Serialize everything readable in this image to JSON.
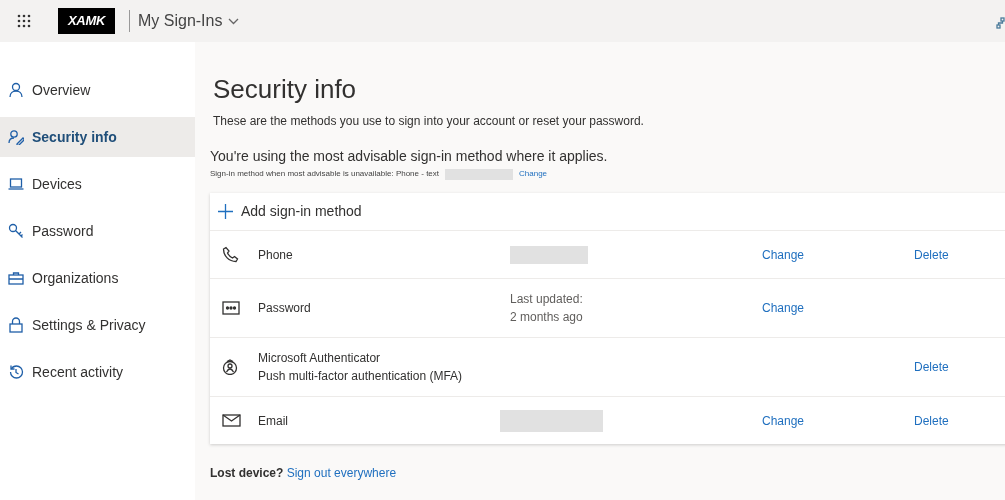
{
  "header": {
    "app_title": "My Sign-Ins",
    "logo_text": "XAMK"
  },
  "sidebar": {
    "items": [
      {
        "label": "Overview",
        "kind": "person",
        "selected": false
      },
      {
        "label": "Security info",
        "kind": "security",
        "selected": true
      },
      {
        "label": "Devices",
        "kind": "devices",
        "selected": false
      },
      {
        "label": "Password",
        "kind": "password",
        "selected": false
      },
      {
        "label": "Organizations",
        "kind": "organizations",
        "selected": false
      },
      {
        "label": "Settings & Privacy",
        "kind": "settings",
        "selected": false
      },
      {
        "label": "Recent activity",
        "kind": "activity",
        "selected": false
      }
    ]
  },
  "main": {
    "title": "Security info",
    "subtitle": "These are the methods you use to sign into your account or reset your password.",
    "advisable_note": "You're using the most advisable sign-in method where it applies.",
    "fallback_note": "Sign-in method when most advisable is unavailable: Phone - text",
    "fallback_redacted": true,
    "fallback_link": "Change",
    "add_method": "Add sign-in method",
    "methods": [
      {
        "kind": "phone",
        "name": "Phone",
        "detail_redacted": true,
        "change": "Change",
        "delete": "Delete"
      },
      {
        "kind": "password",
        "name": "Password",
        "detail_lines": [
          "Last updated:",
          "2 months ago"
        ],
        "change": "Change"
      },
      {
        "kind": "authenticator",
        "name": "Microsoft Authenticator",
        "subname": "Push multi-factor authentication (MFA)",
        "delete": "Delete"
      },
      {
        "kind": "email",
        "name": "Email",
        "detail_redacted": true,
        "change": "Change",
        "delete": "Delete"
      }
    ],
    "lost_device": {
      "label": "Lost device?",
      "link": "Sign out everywhere"
    }
  }
}
